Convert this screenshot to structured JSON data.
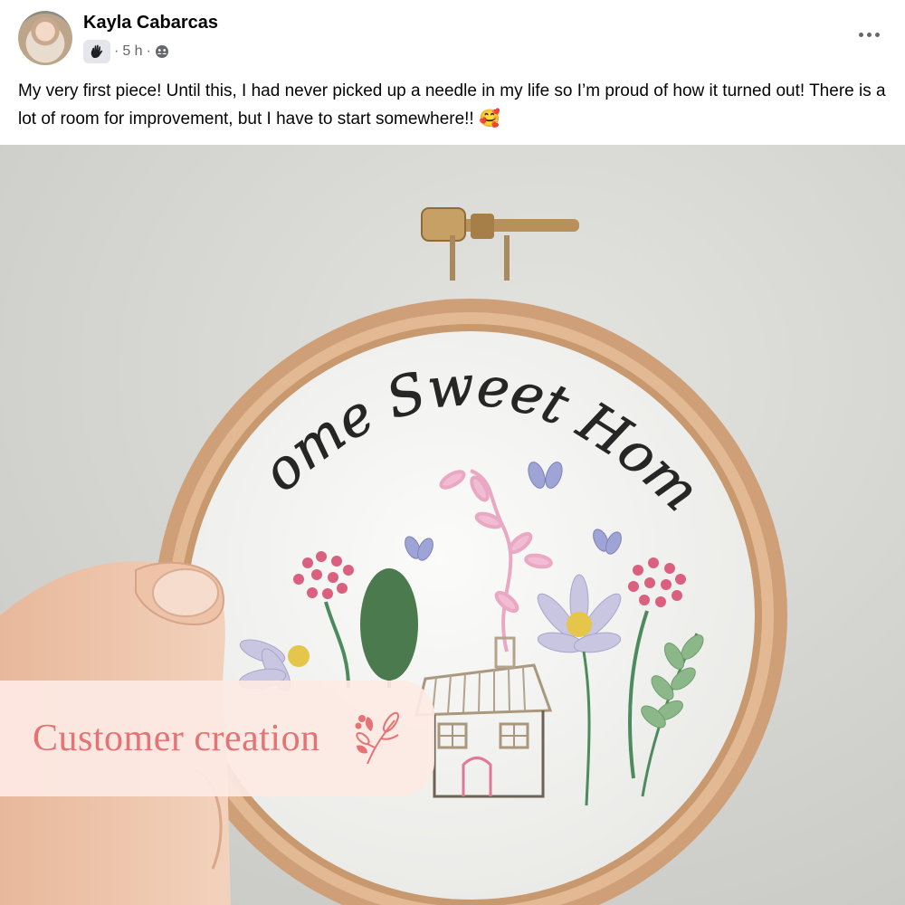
{
  "post": {
    "author": "Kayla Cabarcas",
    "time": "5 h",
    "dot": "·",
    "audience_icon": "group-audience-icon",
    "badge_icon": "waving-hand-badge-icon",
    "text": "My very first piece! Until this, I had never picked up a needle in my life so I’m proud of how it turned out! There is a lot of room for improvement, but I have to start somewhere!!",
    "emoji": "🥰"
  },
  "photo": {
    "embroidery_text": "Home Sweet Home",
    "overlay_label": "Customer creation",
    "overlay_icon": "sprig-icon",
    "colors": {
      "wall": "#d8d8d4",
      "hoop": "#d8ad87",
      "fabric": "#f4f4f2",
      "overlay_bg": "#fde9e4",
      "overlay_text": "#e57373"
    }
  }
}
